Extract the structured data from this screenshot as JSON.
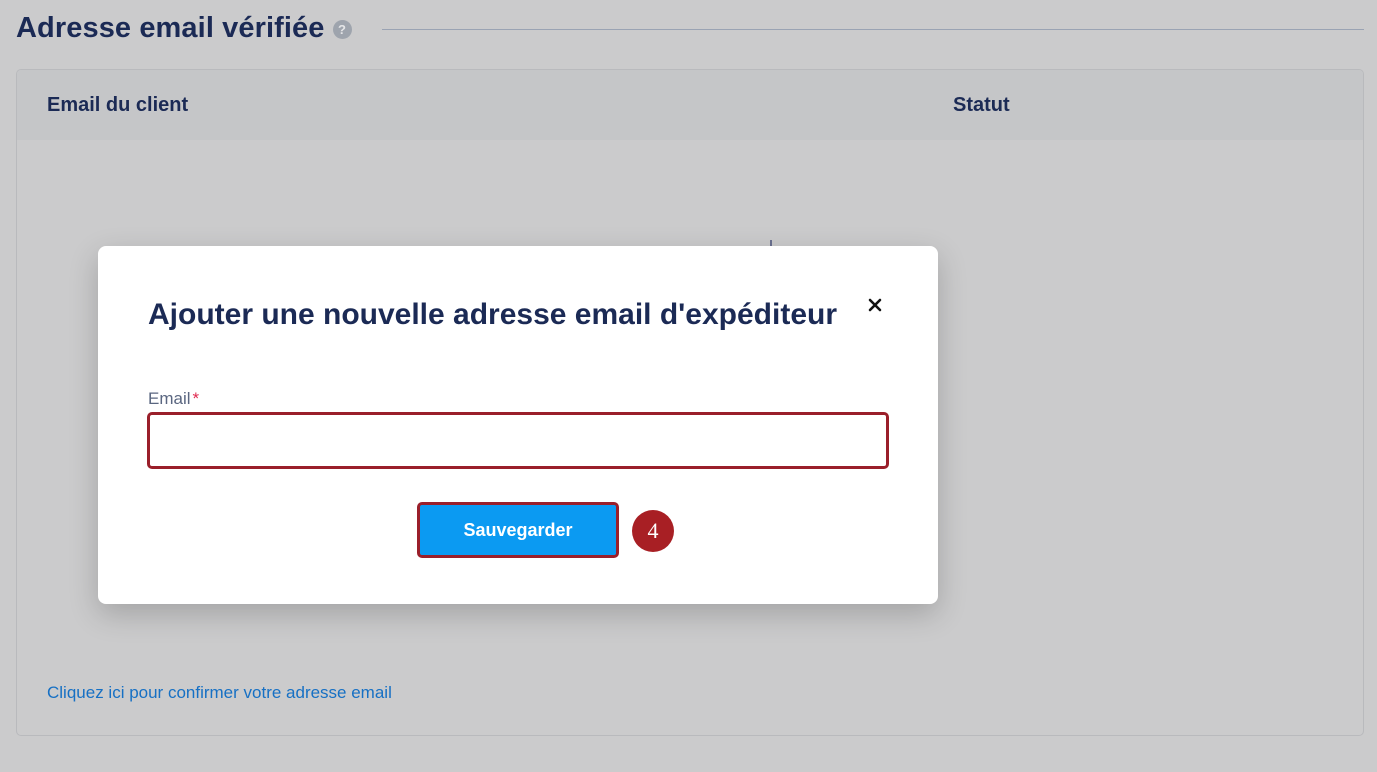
{
  "section": {
    "title": "Adresse email vérifiée",
    "help_icon": "question-icon"
  },
  "table": {
    "columns": [
      "Email du client",
      "Statut"
    ],
    "rows": []
  },
  "link": {
    "confirm_email": "Cliquez ici pour confirmer votre adresse email"
  },
  "modal": {
    "title": "Ajouter une nouvelle adresse email d'expéditeur",
    "close_icon": "close-icon",
    "email_label": "Email",
    "required_mark": "*",
    "email_value": "",
    "email_placeholder": "",
    "save_label": "Sauvegarder",
    "step_number": "4"
  },
  "colors": {
    "title": "#1b2a55",
    "primary_button": "#0b9af2",
    "highlight_border": "#9a1f2a",
    "step_badge": "#a81f24",
    "link": "#1670c4",
    "required": "#e0294f"
  }
}
